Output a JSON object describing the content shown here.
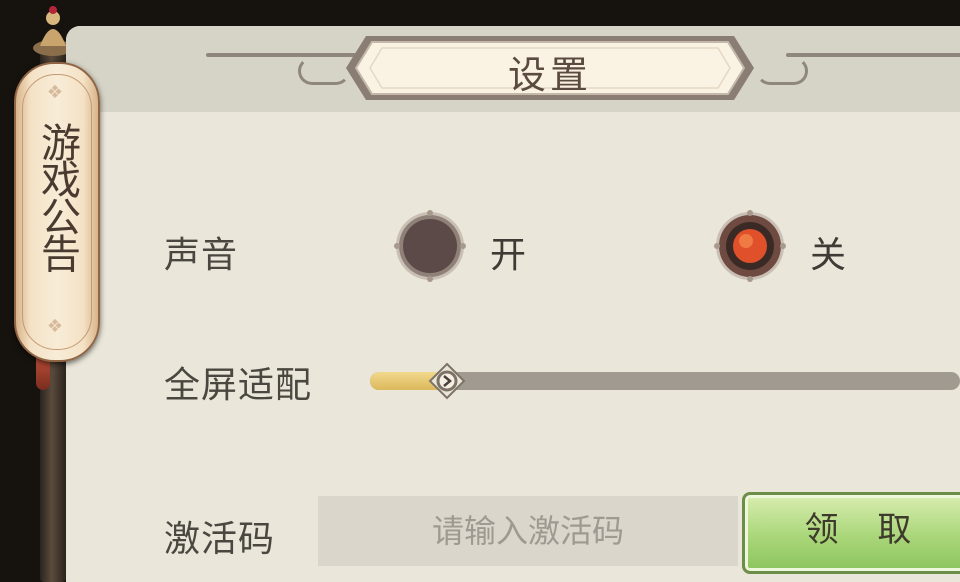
{
  "announcement_tab": {
    "label": "游戏公告"
  },
  "settings_panel": {
    "title": "设置",
    "sound": {
      "label": "声音",
      "options": [
        {
          "label": "开",
          "selected": false
        },
        {
          "label": "关",
          "selected": true
        }
      ]
    },
    "fullscreen": {
      "label": "全屏适配",
      "value_fraction": 0.13
    },
    "activation": {
      "label": "激活码",
      "input_value": "",
      "placeholder": "请输入激活码",
      "claim_label": "领 取"
    }
  },
  "colors": {
    "panel_bg": "#eae6da",
    "header_bg": "#d6d3c7",
    "radio_selected": "#e0502a",
    "radio_unselected": "#5b4a47",
    "slider_fill": "#e8c870",
    "button_green": "#a9d679"
  }
}
